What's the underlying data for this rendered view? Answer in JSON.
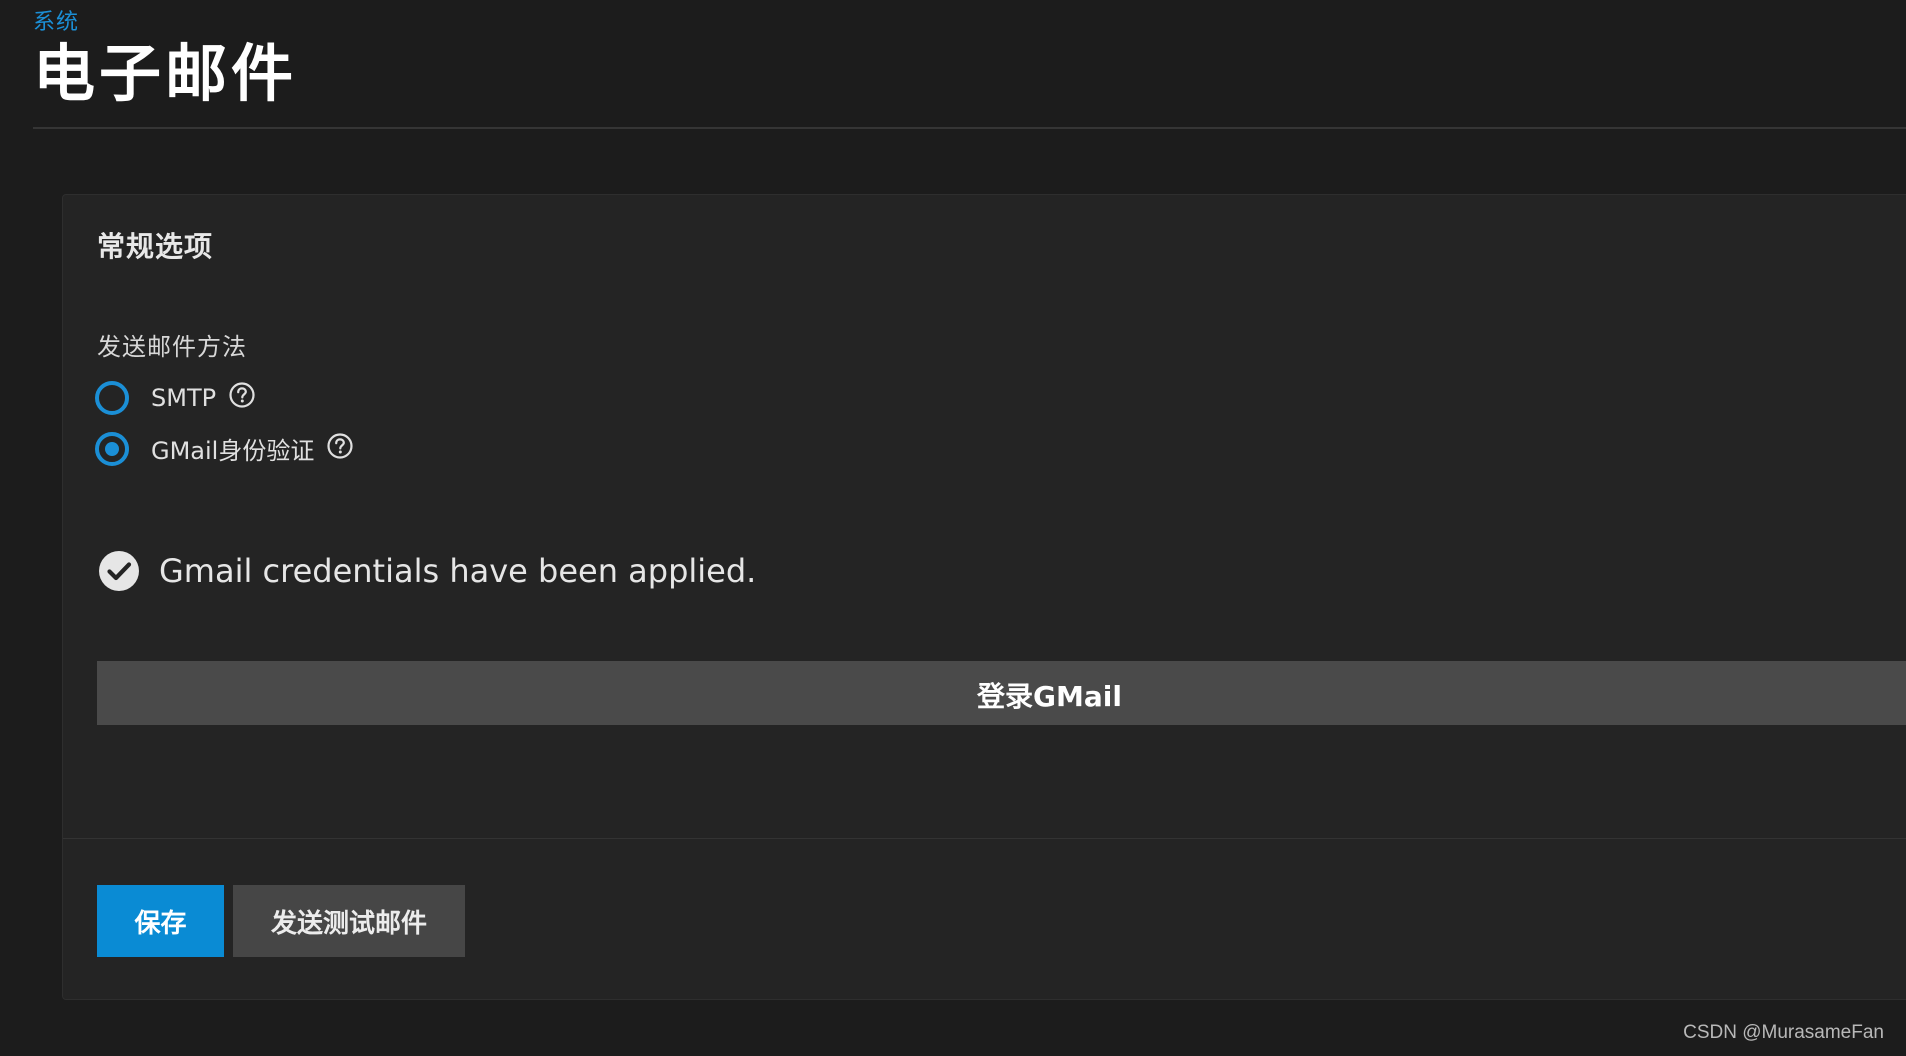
{
  "breadcrumb": "系统",
  "page_title": "电子邮件",
  "card": {
    "title": "常规选项",
    "method_label": "发送邮件方法",
    "options": [
      {
        "label": "SMTP",
        "selected": false
      },
      {
        "label": "GMail身份验证",
        "selected": true
      }
    ],
    "status_text": "Gmail credentials have been applied.",
    "gmail_button": "登录GMail",
    "save_button": "保存",
    "test_button": "发送测试邮件"
  },
  "watermark": "CSDN @MurasameFan",
  "colors": {
    "accent": "#1b8fd6",
    "primary_button": "#0a8bd4",
    "secondary_button": "#464646",
    "background": "#1c1c1c",
    "card": "#242424"
  },
  "icons": {
    "help": "question-circle-icon",
    "status": "check-circle-icon"
  }
}
